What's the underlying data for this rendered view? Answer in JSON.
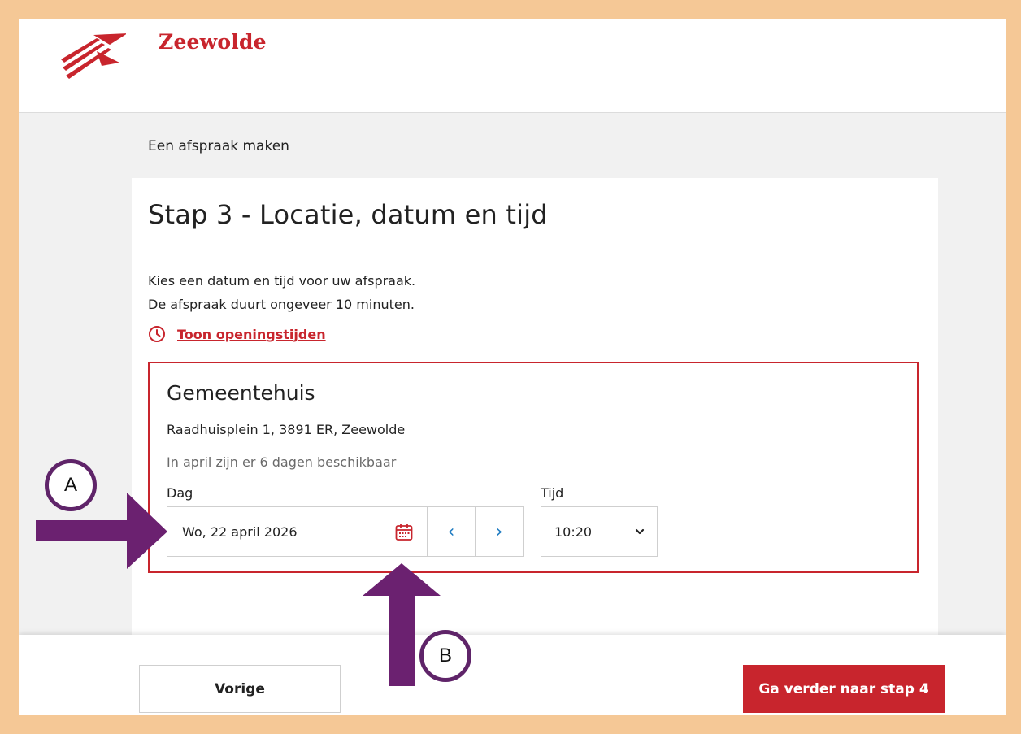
{
  "header": {
    "brand": "Zeewolde",
    "logo_icon": "zeewolde-logo-icon"
  },
  "page": {
    "subtitle": "Een afspraak maken"
  },
  "step": {
    "title": "Stap 3 - Locatie, datum en tijd",
    "intro_line1": "Kies een datum en tijd voor uw afspraak.",
    "intro_line2": "De afspraak duurt ongeveer 10 minuten.",
    "hours_link": "Toon openingstijden"
  },
  "location": {
    "name": "Gemeentehuis",
    "address": "Raadhuisplein 1, 3891 ER, Zeewolde",
    "availability": "In april zijn er 6 dagen beschikbaar",
    "day_label": "Dag",
    "day_value": "Wo, 22 april 2026",
    "time_label": "Tijd",
    "time_value": "10:20",
    "prev_day_glyph": "‹",
    "next_day_glyph": "›"
  },
  "footer": {
    "prev_label": "Vorige",
    "next_label": "Ga verder naar stap 4"
  },
  "annotations": {
    "a_label": "A",
    "b_label": "B"
  },
  "colors": {
    "accent": "#c8252d",
    "link_blue": "#1e7bc1",
    "annotation": "#5f2469",
    "frame": "#f5c896"
  }
}
